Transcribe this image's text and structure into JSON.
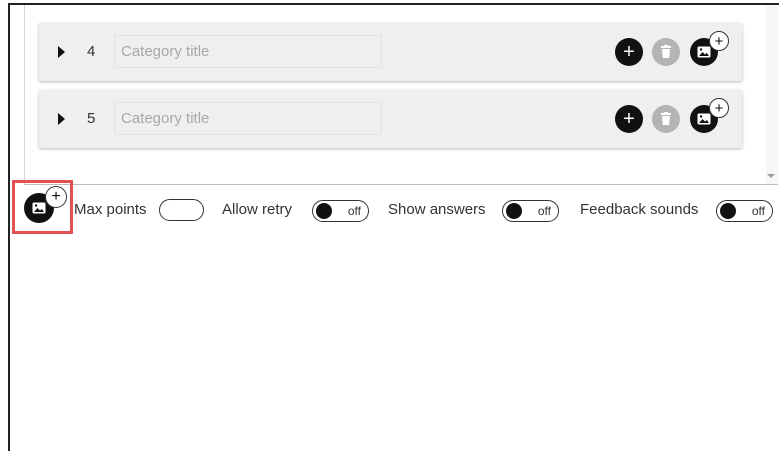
{
  "categories": [
    {
      "number": "4",
      "title_placeholder": "Category title",
      "title_value": ""
    },
    {
      "number": "5",
      "title_placeholder": "Category title",
      "title_value": ""
    }
  ],
  "icons": {
    "expand": "caret-right-icon",
    "add": "plus-icon",
    "delete": "trash-icon",
    "image": "image-icon",
    "image_add_badge": "plus-icon",
    "scroll_down": "chevron-down-icon"
  },
  "row_buttons": {
    "add_glyph": "+",
    "badge_glyph": "+"
  },
  "settings": {
    "add_image_badge": "+",
    "max_points_label": "Max points",
    "max_points_value": "",
    "allow_retry_label": "Allow retry",
    "allow_retry_state": "off",
    "show_answers_label": "Show answers",
    "show_answers_state": "off",
    "feedback_sounds_label": "Feedback sounds",
    "feedback_sounds_state": "off"
  },
  "colors": {
    "row_background": "#efefef",
    "primary_button": "#111111",
    "disabled_button": "#b4b4b4",
    "highlight_border": "#e05252"
  }
}
